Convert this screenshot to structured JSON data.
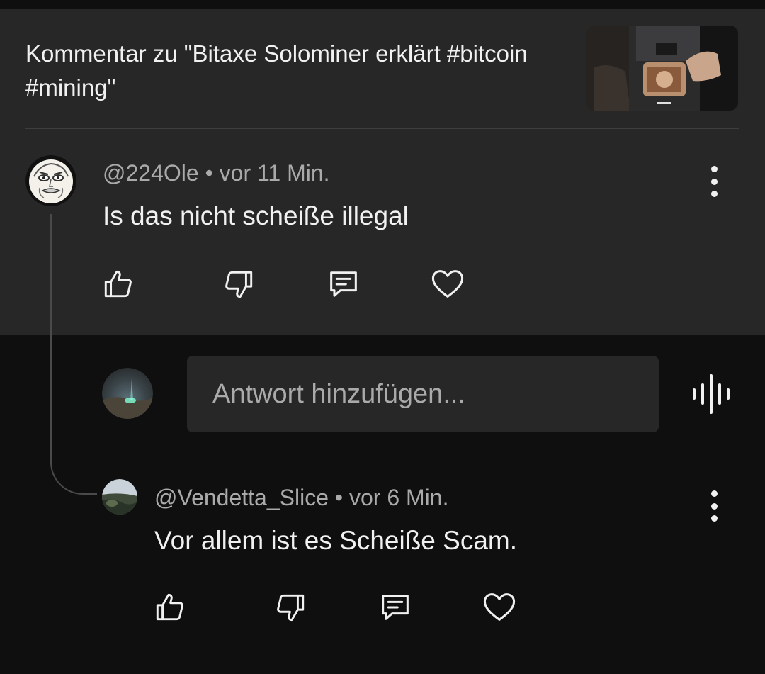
{
  "video": {
    "comment_on_label": "Kommentar zu \"Bitaxe Solominer erklärt #bitcoin #mining\""
  },
  "comment": {
    "author": "@224Ole",
    "separator": " • ",
    "time": "vor 11 Min.",
    "text": "Is das nicht scheiße illegal"
  },
  "reply_box": {
    "placeholder": "Antwort hinzufügen..."
  },
  "reply": {
    "author": "@Vendetta_Slice",
    "separator": " • ",
    "time": "vor 6 Min.",
    "text": "Vor allem ist es Scheiße Scam."
  },
  "icons": {
    "like": "thumbs-up-icon",
    "dislike": "thumbs-down-icon",
    "reply": "comment-icon",
    "heart": "heart-icon",
    "more": "more-vert-icon",
    "voice": "voice-search-icon"
  },
  "colors": {
    "background": "#0f0f0f",
    "surface": "#272727",
    "text_primary": "#f1f1f1",
    "text_secondary": "#aaaaaa"
  }
}
